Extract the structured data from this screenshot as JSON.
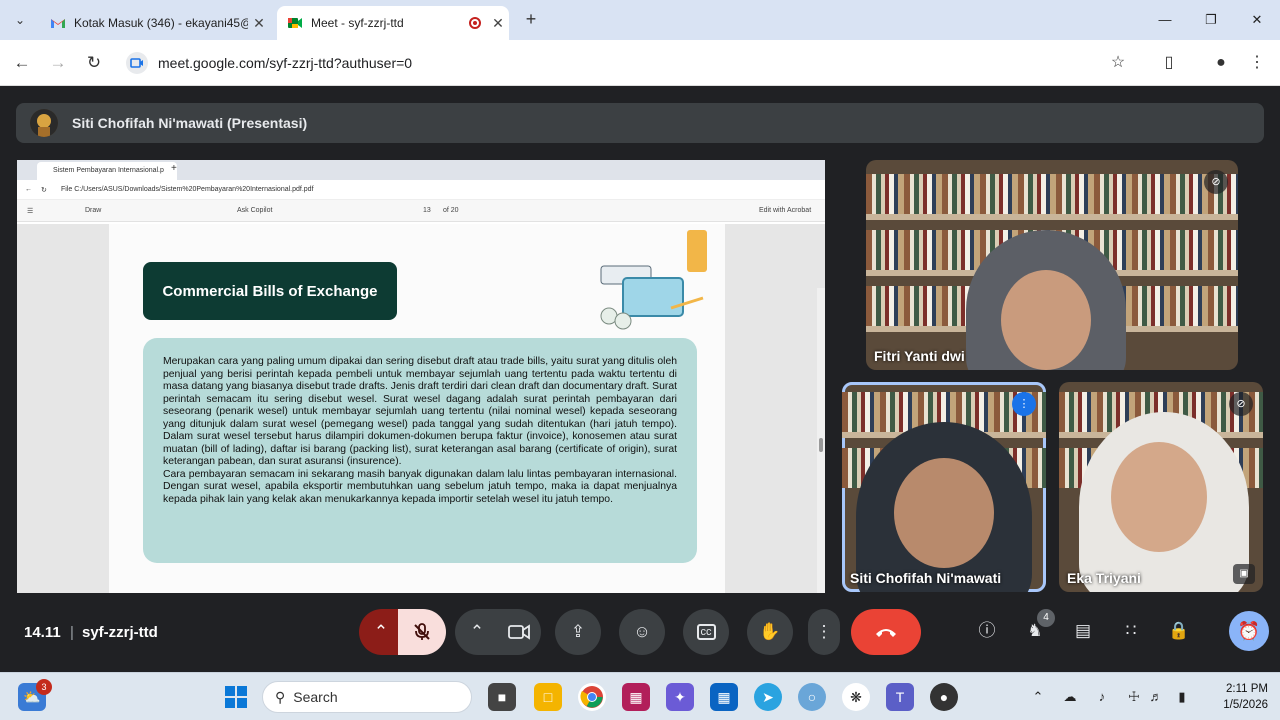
{
  "browser": {
    "tabs": [
      {
        "title": "Kotak Masuk (346) - ekayani45@",
        "icon": "gmail-icon"
      },
      {
        "title": "Meet - syf-zzrj-ttd",
        "icon": "meet-icon",
        "recording": true
      }
    ],
    "url": "meet.google.com/syf-zzrj-ttd?authuser=0"
  },
  "meet": {
    "presenter_label": "Siti Chofifah Ni'mawati (Presentasi)",
    "shared_screen": {
      "tab_title": "Sistem Pembayaran Internasional.p",
      "file_url": "File   C:/Users/ASUS/Downloads/Sistem%20Pembayaran%20Internasional.pdf.pdf",
      "toolbar": {
        "draw": "Draw",
        "ask_copilot": "Ask Copilot",
        "page": "13",
        "of_pages": "of 20",
        "edit": "Edit with Acrobat"
      },
      "slide_title": "Commercial Bills of Exchange",
      "slide_text_1": "Merupakan cara yang paling umum dipakai dan sering disebut draft atau trade bills, yaitu surat yang ditulis oleh penjual yang berisi perintah kepada pembeli untuk membayar sejumlah uang tertentu pada waktu tertentu di masa datang yang biasanya disebut trade drafts. Jenis draft terdiri dari clean draft dan documentary draft. Surat perintah semacam itu sering disebut wesel. Surat wesel dagang adalah surat perintah pembayaran dari seseorang (penarik wesel) untuk membayar sejumlah uang tertentu (nilai nominal wesel) kepada seseorang yang ditunjuk dalam surat wesel (pemegang wesel) pada tanggal yang sudah ditentukan (hari jatuh tempo). Dalam surat wesel tersebut harus dilampiri dokumen-dokumen berupa faktur (invoice), konosemen atau surat muatan (bill of lading), daftar isi barang (packing list), surat keterangan asal barang (certificate of origin), surat keterangan pabean, dan surat asuransi (insurence).",
      "slide_text_2": "Cara pembayaran semacam ini sekarang masih banyak digunakan dalam lalu lintas pembayaran internasional. Dengan surat wesel, apabila eksportir membutuhkan uang sebelum jatuh tempo, maka ia dapat menjualnya kepada pihak lain yang kelak akan menukarkannya kepada importir setelah wesel itu jatuh tempo."
    },
    "participants": [
      {
        "name": "Fitri Yanti dwi",
        "muted": true
      },
      {
        "name": "Siti Chofifah Ni'mawati",
        "speaking": true
      },
      {
        "name": "Eka Triyani",
        "muted": true
      }
    ],
    "controls": {
      "time": "14.11",
      "meeting_code": "syf-zzrj-ttd",
      "people_count": "4"
    }
  },
  "taskbar": {
    "search_placeholder": "Search",
    "widget_badge": "3",
    "time": "2:11 PM",
    "date": "1/5/2026"
  }
}
